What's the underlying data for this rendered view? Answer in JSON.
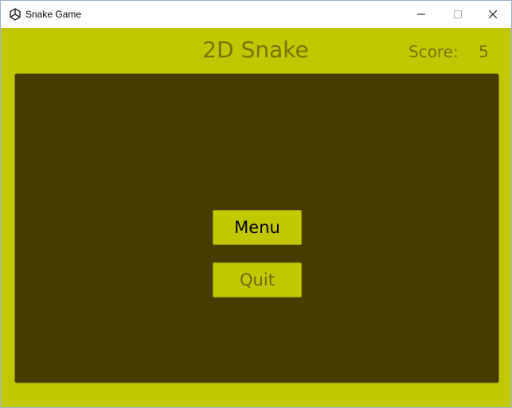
{
  "window": {
    "title": "Snake Game",
    "app_icon": "unity-icon",
    "controls": [
      "minimize-icon",
      "maximize-icon",
      "close-icon"
    ]
  },
  "header": {
    "game_title": "2D Snake",
    "score_label": "Score:",
    "score_value": "5"
  },
  "menu": {
    "menu_label": "Menu",
    "quit_label": "Quit"
  },
  "colors": {
    "background": "#c1c800",
    "board": "#463c00",
    "text_dim": "#7a7400",
    "button": "#c1c800"
  }
}
